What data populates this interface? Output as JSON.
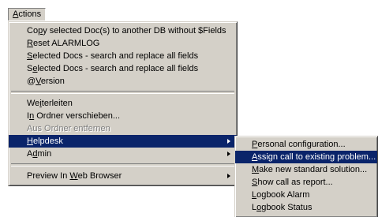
{
  "menubar": {
    "actions": {
      "pre": "",
      "mn": "A",
      "post": "ctions"
    }
  },
  "menu": {
    "items": [
      {
        "pre": "Co",
        "mn": "p",
        "post": "y selected Doc(s) to another DB without $Fields"
      },
      {
        "pre": "",
        "mn": "R",
        "post": "eset ALARMLOG"
      },
      {
        "pre": "",
        "mn": "S",
        "post": "elected Docs - search and replace all fields"
      },
      {
        "pre": "S",
        "mn": "e",
        "post": "lected Docs - search and replace all fields"
      },
      {
        "pre": "@",
        "mn": "V",
        "post": "ersion"
      },
      {
        "pre": "We",
        "mn": "i",
        "post": "terleiten"
      },
      {
        "pre": "I",
        "mn": "n",
        "post": " Ordner verschieben..."
      },
      {
        "pre": "Aus Ordner entfernen",
        "mn": "",
        "post": ""
      },
      {
        "pre": "",
        "mn": "H",
        "post": "elpdesk"
      },
      {
        "pre": "A",
        "mn": "d",
        "post": "min"
      },
      {
        "pre": "Preview In ",
        "mn": "W",
        "post": "eb Browser"
      }
    ]
  },
  "submenu": {
    "items": [
      {
        "pre": "",
        "mn": "P",
        "post": "ersonal configuration..."
      },
      {
        "pre": "",
        "mn": "A",
        "post": "ssign call to existing problem..."
      },
      {
        "pre": "",
        "mn": "M",
        "post": "ake new standard solution..."
      },
      {
        "pre": "",
        "mn": "S",
        "post": "how call as report..."
      },
      {
        "pre": "",
        "mn": "L",
        "post": "ogbook Alarm"
      },
      {
        "pre": "L",
        "mn": "o",
        "post": "gbook Status"
      }
    ]
  },
  "colors": {
    "menu_bg": "#d4d0c8",
    "highlight": "#0a246a",
    "disabled": "#808080"
  },
  "icons": {
    "submenu_arrow": "right-triangle"
  }
}
